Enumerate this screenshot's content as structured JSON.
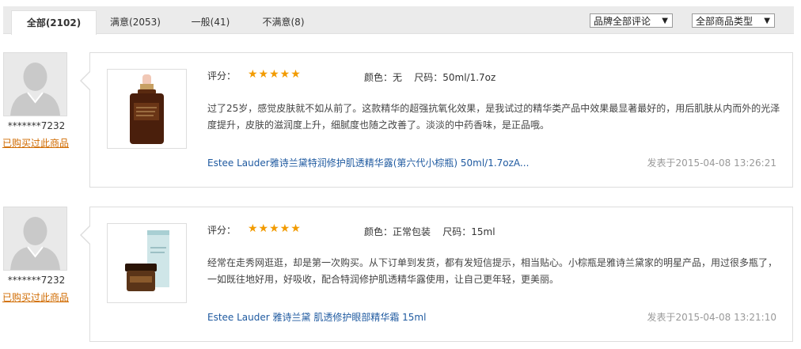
{
  "tabs": [
    {
      "label": "全部(2102)",
      "active": true
    },
    {
      "label": "满意(2053)",
      "active": false
    },
    {
      "label": "一般(41)",
      "active": false
    },
    {
      "label": "不满意(8)",
      "active": false
    }
  ],
  "filters": {
    "brand": "品牌全部评论",
    "type": "全部商品类型",
    "arrow": "▼"
  },
  "colors": {
    "star": "#f29b00",
    "link": "#1f5aa0",
    "bought": "#d06b00",
    "date": "#999999"
  },
  "reviews": [
    {
      "username": "*******7232",
      "bought_label": "已购买过此商品",
      "score_label": "评分：",
      "stars": "★★★★★",
      "rating": 5,
      "spec": "颜色：无    尺码：50ml/1.7oz",
      "content": "过了25岁，感觉皮肤就不如从前了。这款精华的超强抗氧化效果，是我试过的精华类产品中效果最显著最好的，用后肌肤从内而外的光泽度提升，皮肤的滋润度上升，细腻度也随之改善了。淡淡的中药香味，是正品哦。",
      "product_name": "Estee Lauder雅诗兰黛特润修护肌透精华露(第六代小棕瓶) 50ml/1.7ozA...",
      "date": "发表于2015-04-08 13:26:21"
    },
    {
      "username": "*******7232",
      "bought_label": "已购买过此商品",
      "score_label": "评分：",
      "stars": "★★★★★",
      "rating": 5,
      "spec": "颜色：正常包装    尺码：15ml",
      "content": "经常在走秀网逛逛，却是第一次购买。从下订单到发货，都有发短信提示，相当贴心。小棕瓶是雅诗兰黛家的明星产品，用过很多瓶了，一如既往地好用，好吸收，配合特润修护肌透精华露使用，让自己更年轻，更美丽。",
      "product_name": "Estee Lauder 雅诗兰黛 肌透修护眼部精华霜 15ml",
      "date": "发表于2015-04-08 13:21:10"
    }
  ]
}
